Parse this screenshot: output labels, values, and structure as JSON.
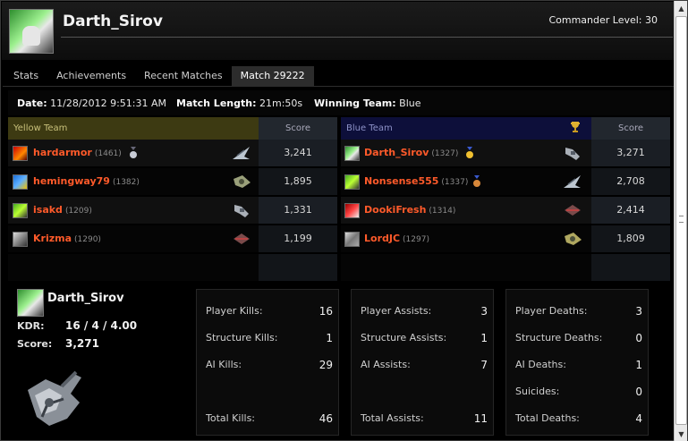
{
  "header": {
    "player_name": "Darth_Sirov",
    "commander_level": "Commander Level: 30"
  },
  "tabs": [
    {
      "label": "Stats",
      "active": false
    },
    {
      "label": "Achievements",
      "active": false
    },
    {
      "label": "Recent Matches",
      "active": false
    },
    {
      "label": "Match 29222",
      "active": true
    }
  ],
  "match_info": {
    "date_label": "Date:",
    "date_value": "11/28/2012 9:51:31 AM",
    "length_label": "Match Length:",
    "length_value": "21m:50s",
    "winner_label": "Winning Team:",
    "winner_value": "Blue"
  },
  "yellow_team": {
    "title": "Yellow Team",
    "score_header": "Score",
    "color": "#3d3a12",
    "players": [
      {
        "name": "hardarmor",
        "rating": "(1461)",
        "score": "3,241",
        "medal": "silver-medal-icon"
      },
      {
        "name": "hemingway79",
        "rating": "(1382)",
        "score": "1,895",
        "medal": ""
      },
      {
        "name": "isakd",
        "rating": "(1209)",
        "score": "1,331",
        "medal": ""
      },
      {
        "name": "Krizma",
        "rating": "(1290)",
        "score": "1,199",
        "medal": ""
      }
    ]
  },
  "blue_team": {
    "title": "Blue Team",
    "score_header": "Score",
    "color": "#0d0f3a",
    "winner_icon": "trophy-icon",
    "players": [
      {
        "name": "Darth_Sirov",
        "rating": "(1327)",
        "score": "3,271",
        "medal": "gold-medal-icon"
      },
      {
        "name": "Nonsense555",
        "rating": "(1337)",
        "score": "2,708",
        "medal": "bronze-medal-icon"
      },
      {
        "name": "DookiFresh",
        "rating": "(1314)",
        "score": "2,414",
        "medal": ""
      },
      {
        "name": "LordJC",
        "rating": "(1297)",
        "score": "1,809",
        "medal": ""
      }
    ]
  },
  "summary": {
    "name": "Darth_Sirov",
    "kdr_label": "KDR:",
    "kdr_value": "16 / 4 / 4.00",
    "score_label": "Score:",
    "score_value": "3,271"
  },
  "kills": {
    "player_kills_label": "Player Kills:",
    "player_kills": "16",
    "structure_kills_label": "Structure Kills:",
    "structure_kills": "1",
    "ai_kills_label": "AI Kills:",
    "ai_kills": "29",
    "total_kills_label": "Total Kills:",
    "total_kills": "46"
  },
  "assists": {
    "player_assists_label": "Player Assists:",
    "player_assists": "3",
    "structure_assists_label": "Structure Assists:",
    "structure_assists": "1",
    "ai_assists_label": "AI Assists:",
    "ai_assists": "7",
    "total_assists_label": "Total Assists:",
    "total_assists": "11"
  },
  "deaths": {
    "player_deaths_label": "Player Deaths:",
    "player_deaths": "3",
    "structure_deaths_label": "Structure Deaths:",
    "structure_deaths": "0",
    "ai_deaths_label": "AI Deaths:",
    "ai_deaths": "1",
    "suicides_label": "Suicides:",
    "suicides": "0",
    "total_deaths_label": "Total Deaths:",
    "total_deaths": "4"
  },
  "colors": {
    "player_name": "#ff5a2a",
    "yellow_header": "#3d3a12",
    "blue_header": "#0d0f3a"
  }
}
